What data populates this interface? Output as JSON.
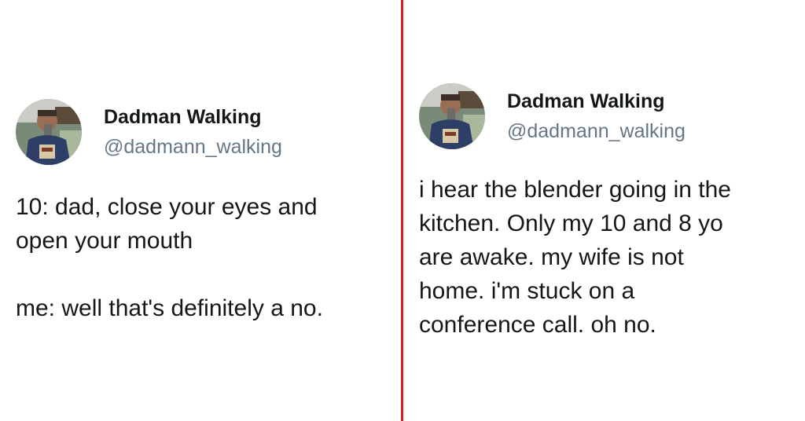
{
  "colors": {
    "divider": "#e0191b",
    "name": "#14171a",
    "handle": "#657786"
  },
  "left_tweet": {
    "display_name": "Dadman Walking",
    "handle": "@dadmann_walking",
    "avatar_icon": "profile-photo",
    "line1": "10: dad, close your eyes and",
    "line2": "open your mouth",
    "line3": "me: well that's definitely a no."
  },
  "right_tweet": {
    "display_name": "Dadman Walking",
    "handle": "@dadmann_walking",
    "avatar_icon": "profile-photo",
    "line1": "i hear the blender going in the",
    "line2": "kitchen. Only my 10 and 8 yo",
    "line3": "are awake. my wife is not",
    "line4": "home. i'm stuck on a",
    "line5": "conference call. oh no."
  }
}
